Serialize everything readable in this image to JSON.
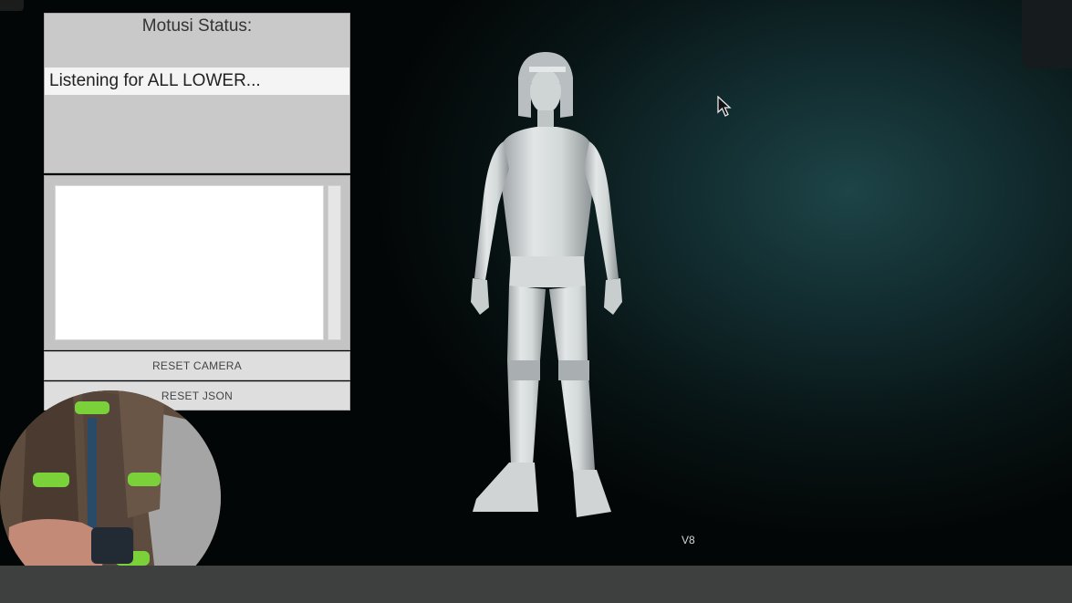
{
  "status": {
    "title": "Motusi Status:",
    "message": "Listening for ALL LOWER..."
  },
  "log": {
    "content": ""
  },
  "buttons": {
    "reset_camera": "RESET CAMERA",
    "reset_json": "RESET JSON"
  },
  "version": "V8",
  "icons": {
    "cursor": "mouse-pointer-icon",
    "avatar": "3d-avatar-figure",
    "webcam": "webcam-overlay"
  },
  "colors": {
    "background": "#0a1a1b",
    "panel": "#c9c9c9",
    "taskbar": "#3e4040",
    "sensor_accent": "#7bd13a"
  }
}
